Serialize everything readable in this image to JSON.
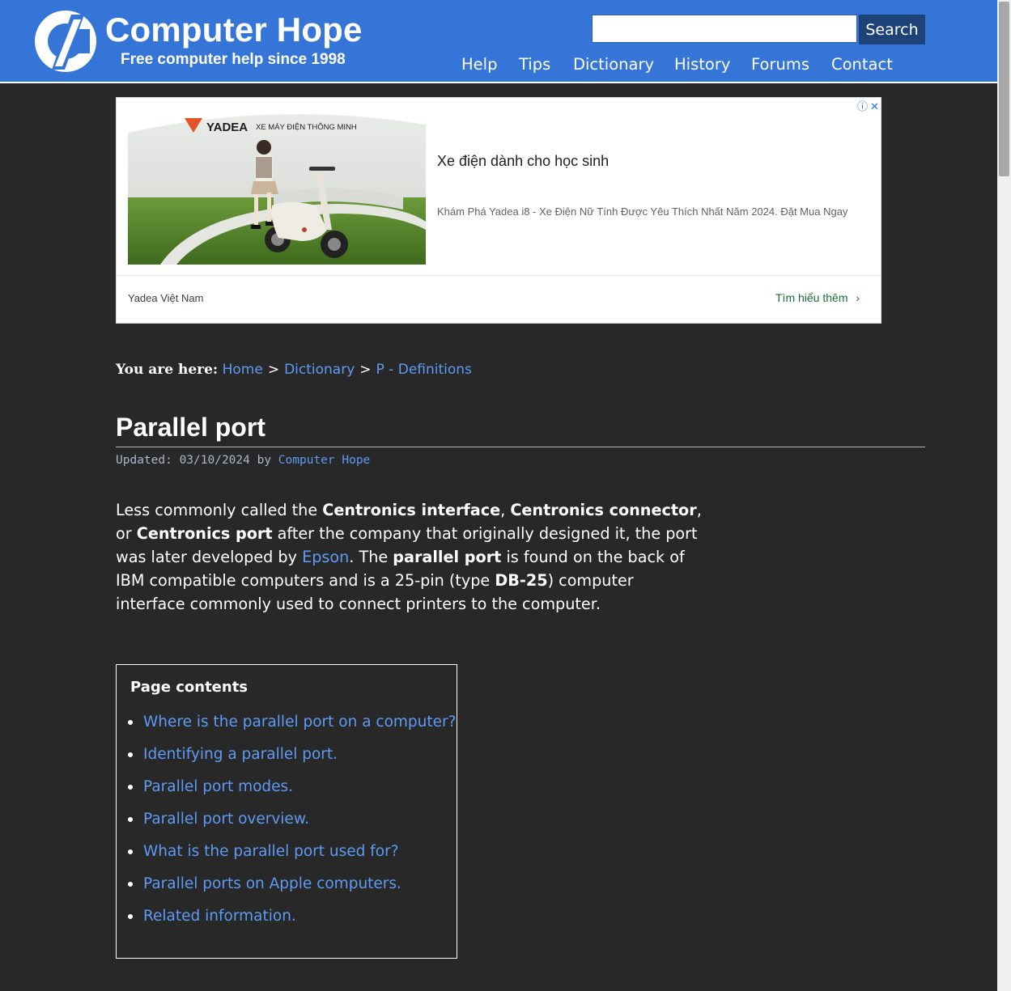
{
  "header": {
    "site_name": "Computer Hope",
    "tagline": "Free computer help since 1998",
    "search": {
      "placeholder": "",
      "value": "",
      "button_label": "Search"
    },
    "nav": [
      "Help",
      "Tips",
      "Dictionary",
      "History",
      "Forums",
      "Contact"
    ]
  },
  "ad": {
    "brand": "YADEA",
    "brand_tagline": "XE MÁY ĐIỆN THÔNG MINH",
    "headline": "Xe điện dành cho học sinh",
    "description": "Khám Phá Yadea i8 - Xe Điện Nữ Tính Được Yêu Thích Nhất Năm 2024. Đặt Mua Ngay",
    "advertiser": "Yadea Việt Nam",
    "cta": "Tìm hiểu thêm"
  },
  "breadcrumb": {
    "label": "You are here:",
    "items": [
      "Home",
      "Dictionary",
      "P - Definitions"
    ],
    "separator": ">"
  },
  "article": {
    "title": "Parallel port",
    "updated_prefix": "Updated: 03/10/2024 by",
    "author": "Computer Hope",
    "intro": {
      "t1": "Less commonly called the ",
      "b1": "Centronics interface",
      "t2": ", ",
      "b2": "Centronics connector",
      "t3": ", or ",
      "b3": "Centronics port",
      "t4": " after the company that originally designed it, the port was later developed by ",
      "link": "Epson",
      "t5": ". The ",
      "b4": "parallel port",
      "t6": " is found on the back of IBM compatible computers and is a 25-pin (type ",
      "b5": "DB-25",
      "t7": ") computer interface commonly used to connect printers to the computer."
    }
  },
  "toc": {
    "title": "Page contents",
    "items": [
      "Where is the parallel port on a computer?",
      "Identifying a parallel port.",
      "Parallel port modes.",
      "Parallel port overview.",
      "What is the parallel port used for?",
      "Parallel ports on Apple computers.",
      "Related information."
    ]
  },
  "colors": {
    "header_bg": "#3575d8",
    "page_bg": "#282828",
    "link": "#5e9bf5"
  }
}
